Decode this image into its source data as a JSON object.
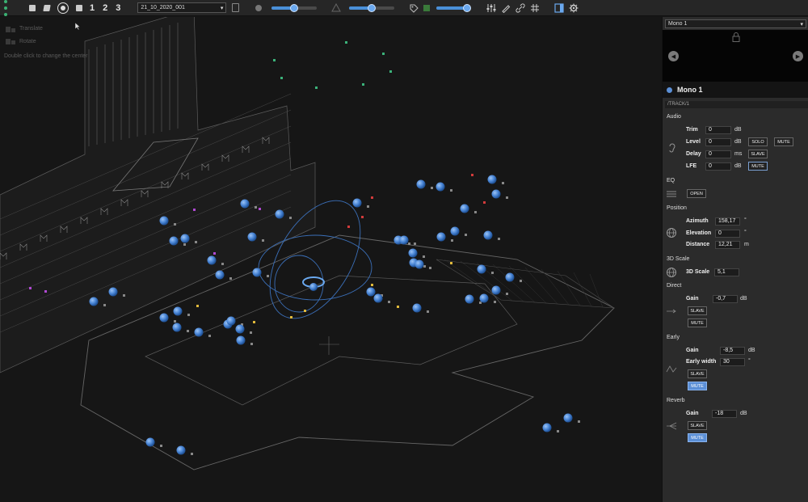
{
  "toolbar": {
    "nums": [
      "1",
      "2",
      "3"
    ],
    "scene_select": "21_10_2020_001",
    "slider1": 0.5,
    "slider2": 0.5,
    "slider3": 0.95
  },
  "viewport": {
    "hint_translate": "Translate",
    "hint_rotate": "Rotate",
    "hint_double_click": "Double click to change the center"
  },
  "panel": {
    "select_value": "Mono 1",
    "track_name": "Mono 1",
    "track_path": "/TRACK/1",
    "audio": {
      "title": "Audio",
      "trim_label": "Trim",
      "trim_value": "0",
      "trim_unit": "dB",
      "level_label": "Level",
      "level_value": "0",
      "level_unit": "dB",
      "delay_label": "Delay",
      "delay_value": "0",
      "delay_unit": "ms",
      "lfe_label": "LFE",
      "lfe_value": "0",
      "lfe_unit": "dB",
      "solo": "SOLO",
      "mute": "MUTE",
      "slave": "SLAVE",
      "mute2": "MUTE"
    },
    "eq": {
      "title": "EQ",
      "open": "OPEN"
    },
    "position": {
      "title": "Position",
      "azimuth_label": "Azimuth",
      "azimuth_value": "158,17",
      "azimuth_unit": "°",
      "elevation_label": "Elevation",
      "elevation_value": "0",
      "elevation_unit": "°",
      "distance_label": "Distance",
      "distance_value": "12,21",
      "distance_unit": "m"
    },
    "scale": {
      "title": "3D Scale",
      "label": "3D Scale",
      "value": "5,1"
    },
    "direct": {
      "title": "Direct",
      "gain_label": "Gain",
      "gain_value": "-0,7",
      "gain_unit": "dB",
      "slave": "SLAVE",
      "mute": "MUTE"
    },
    "early": {
      "title": "Early",
      "gain_label": "Gain",
      "gain_value": "-8,5",
      "gain_unit": "dB",
      "width_label": "Early width",
      "width_value": "30",
      "width_unit": "°",
      "slave": "SLAVE",
      "mute": "MUTE"
    },
    "reverb": {
      "title": "Reverb",
      "gain_label": "Gain",
      "gain_value": "-18",
      "gain_unit": "dB",
      "slave": "SLAVE",
      "mute": "MUTE"
    }
  },
  "colors": {
    "accent": "#5b8fd6",
    "sphere": "#4a86d6",
    "background": "#161616",
    "panel": "#2b2b2b"
  }
}
